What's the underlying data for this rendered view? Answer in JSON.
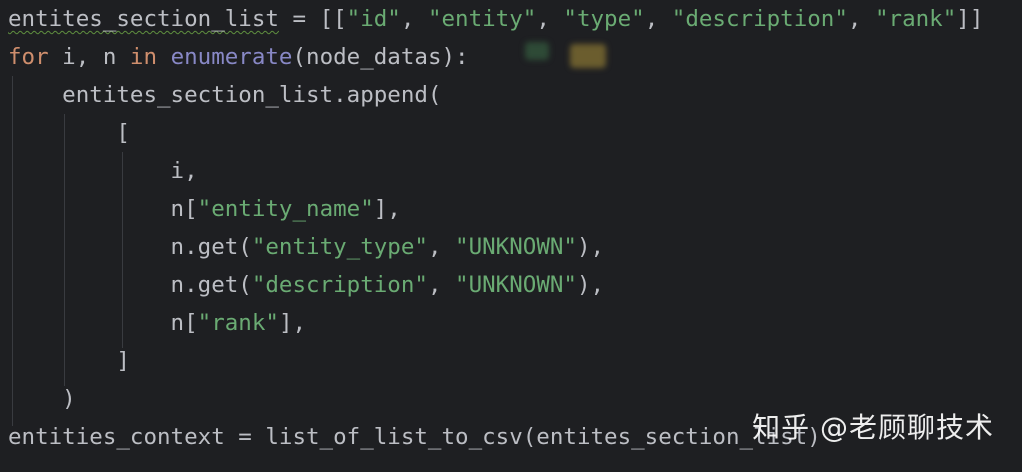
{
  "editor": {
    "lines": [
      {
        "id": "line-1",
        "tokens": [
          {
            "text": "entites_section_list",
            "type": "plain",
            "squiggle": true
          },
          {
            "text": " = [[",
            "type": "plain"
          },
          {
            "text": "\"id\"",
            "type": "str"
          },
          {
            "text": ", ",
            "type": "plain"
          },
          {
            "text": "\"entity\"",
            "type": "str"
          },
          {
            "text": ", ",
            "type": "plain"
          },
          {
            "text": "\"type\"",
            "type": "str"
          },
          {
            "text": ", ",
            "type": "plain"
          },
          {
            "text": "\"description\"",
            "type": "str"
          },
          {
            "text": ", ",
            "type": "plain"
          },
          {
            "text": "\"rank\"",
            "type": "str"
          },
          {
            "text": "]]",
            "type": "plain"
          }
        ]
      },
      {
        "id": "line-2",
        "tokens": [
          {
            "text": "for",
            "type": "kw"
          },
          {
            "text": " i, n ",
            "type": "plain"
          },
          {
            "text": "in",
            "type": "kw"
          },
          {
            "text": " ",
            "type": "plain"
          },
          {
            "text": "enumerate",
            "type": "builtin"
          },
          {
            "text": "(node_datas):",
            "type": "plain"
          }
        ]
      },
      {
        "id": "line-3",
        "tokens": [
          {
            "text": "    entites_section_list.append(",
            "type": "plain"
          }
        ]
      },
      {
        "id": "line-4",
        "tokens": [
          {
            "text": "        [",
            "type": "plain"
          }
        ]
      },
      {
        "id": "line-5",
        "tokens": [
          {
            "text": "            i,",
            "type": "plain"
          }
        ]
      },
      {
        "id": "line-6",
        "tokens": [
          {
            "text": "            n[",
            "type": "plain"
          },
          {
            "text": "\"entity_name\"",
            "type": "str"
          },
          {
            "text": "],",
            "type": "plain"
          }
        ]
      },
      {
        "id": "line-7",
        "tokens": [
          {
            "text": "            n.get(",
            "type": "plain"
          },
          {
            "text": "\"entity_type\"",
            "type": "str"
          },
          {
            "text": ", ",
            "type": "plain"
          },
          {
            "text": "\"UNKNOWN\"",
            "type": "str"
          },
          {
            "text": "),",
            "type": "plain"
          }
        ]
      },
      {
        "id": "line-8",
        "tokens": [
          {
            "text": "            n.get(",
            "type": "plain"
          },
          {
            "text": "\"description\"",
            "type": "str"
          },
          {
            "text": ", ",
            "type": "plain"
          },
          {
            "text": "\"UNKNOWN\"",
            "type": "str"
          },
          {
            "text": "),",
            "type": "plain"
          }
        ]
      },
      {
        "id": "line-9",
        "tokens": [
          {
            "text": "            n[",
            "type": "plain"
          },
          {
            "text": "\"rank\"",
            "type": "str"
          },
          {
            "text": "],",
            "type": "plain"
          }
        ]
      },
      {
        "id": "line-10",
        "tokens": [
          {
            "text": "        ]",
            "type": "plain"
          }
        ]
      },
      {
        "id": "line-11",
        "tokens": [
          {
            "text": "    )",
            "type": "plain"
          }
        ]
      },
      {
        "id": "line-12",
        "tokens": [
          {
            "text": "entities_context = list_of_list_to_csv(entites_section_list)",
            "type": "plain"
          }
        ]
      }
    ]
  },
  "watermark": {
    "text": "知乎 @老顾聊技术"
  },
  "colors": {
    "background": "#1e1f22",
    "plain": "#bcbec4",
    "keyword": "#cf8e6d",
    "string": "#6aab73",
    "builtin": "#8888c6",
    "indent_guide": "#393b40"
  }
}
